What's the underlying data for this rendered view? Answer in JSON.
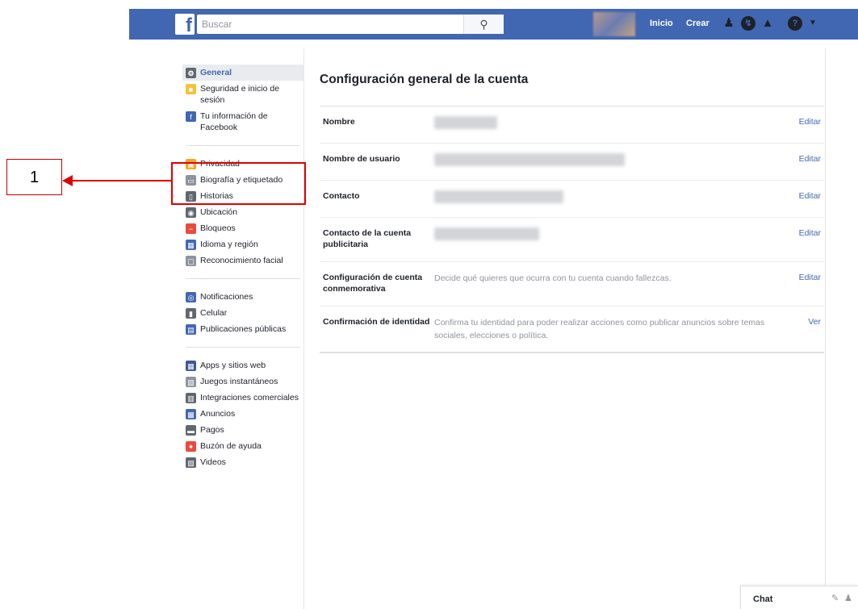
{
  "topbar": {
    "logo": "f",
    "search_placeholder": "Buscar",
    "search_icon": "search-icon",
    "nav": {
      "home": "Inicio",
      "create": "Crear"
    },
    "icons": [
      "friend-requests-icon",
      "messenger-icon",
      "notifications-icon",
      "help-icon",
      "chevron-down-icon"
    ],
    "color": "#4267b2"
  },
  "sidebar": {
    "groups": [
      [
        {
          "label": "General",
          "icon": "gear-icon",
          "color": "#606770",
          "active": true
        },
        {
          "label": "Seguridad e inicio de sesión",
          "icon": "badge-icon",
          "color": "#f5c33b"
        },
        {
          "label": "Tu información de Facebook",
          "icon": "facebook-icon",
          "color": "#4267b2"
        }
      ],
      [
        {
          "label": "Privacidad",
          "icon": "lock-icon",
          "color": "#f5a623"
        },
        {
          "label": "Biografía y etiquetado",
          "icon": "timeline-icon",
          "color": "#8d949e"
        },
        {
          "label": "Historias",
          "icon": "book-icon",
          "color": "#606770"
        },
        {
          "label": "Ubicación",
          "icon": "location-icon",
          "color": "#606770"
        },
        {
          "label": "Bloqueos",
          "icon": "block-icon",
          "color": "#e74c3c"
        },
        {
          "label": "Idioma y región",
          "icon": "language-icon",
          "color": "#4267b2"
        },
        {
          "label": "Reconocimiento facial",
          "icon": "face-icon",
          "color": "#8d949e"
        }
      ],
      [
        {
          "label": "Notificaciones",
          "icon": "globe-icon",
          "color": "#4267b2"
        },
        {
          "label": "Celular",
          "icon": "phone-icon",
          "color": "#606770"
        },
        {
          "label": "Publicaciones públicas",
          "icon": "rss-icon",
          "color": "#4267b2"
        }
      ],
      [
        {
          "label": "Apps y sitios web",
          "icon": "apps-icon",
          "color": "#3b5998"
        },
        {
          "label": "Juegos instantáneos",
          "icon": "game-icon",
          "color": "#8d949e"
        },
        {
          "label": "Integraciones comerciales",
          "icon": "business-icon",
          "color": "#606770"
        },
        {
          "label": "Anuncios",
          "icon": "ads-icon",
          "color": "#4267b2"
        },
        {
          "label": "Pagos",
          "icon": "card-icon",
          "color": "#606770"
        },
        {
          "label": "Buzón de ayuda",
          "icon": "lifebuoy-icon",
          "color": "#e74c3c"
        },
        {
          "label": "Videos",
          "icon": "video-icon",
          "color": "#606770"
        }
      ]
    ]
  },
  "main": {
    "title": "Configuración general de la cuenta",
    "rows": [
      {
        "label": "Nombre",
        "value": "",
        "action": "Editar"
      },
      {
        "label": "Nombre de usuario",
        "value": "",
        "action": "Editar"
      },
      {
        "label": "Contacto",
        "value": "",
        "action": "Editar"
      },
      {
        "label": "Contacto de la cuenta publicitaria",
        "value": "",
        "action": "Editar"
      },
      {
        "label": "Configuración de cuenta conmemorativa",
        "value": "Decide qué quieres que ocurra con tu cuenta cuando fallezcas.",
        "action": "Editar"
      },
      {
        "label": "Confirmación de identidad",
        "value": "Confirma tu identidad para poder realizar acciones como publicar anuncios sobre temas sociales, elecciones o política.",
        "action": "Ver"
      }
    ]
  },
  "annotation": {
    "number": "1",
    "color": "#e00000"
  },
  "chat": {
    "label": "Chat",
    "icons": [
      "compose-icon",
      "contacts-icon"
    ]
  }
}
